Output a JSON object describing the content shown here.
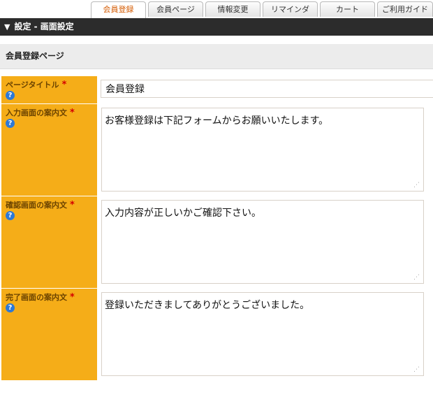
{
  "tabs": [
    {
      "label": "会員登録",
      "active": true
    },
    {
      "label": "会員ページ",
      "active": false
    },
    {
      "label": "情報変更",
      "active": false
    },
    {
      "label": "リマインダ",
      "active": false
    },
    {
      "label": "カート",
      "active": false
    },
    {
      "label": "ご利用ガイド",
      "active": false
    }
  ],
  "titlebar": {
    "icon": "triangle-down-icon",
    "text": "設定 - 画面設定"
  },
  "section": {
    "title": "会員登録ページ"
  },
  "fields": [
    {
      "label": "ページタイトル",
      "required": "*",
      "help": "?",
      "value": "会員登録"
    },
    {
      "label": "入力画面の案内文",
      "required": "*",
      "help": "?",
      "value": "お客様登録は下記フォームからお願いいたします。"
    },
    {
      "label": "確認画面の案内文",
      "required": "*",
      "help": "?",
      "value": "入力内容が正しいかご確認下さい。"
    },
    {
      "label": "完了画面の案内文",
      "required": "*",
      "help": "?",
      "value": "登録いただきましてありがとうございました。"
    }
  ],
  "colors": {
    "label_bg": "#f5ad18",
    "titlebar_bg": "#2c2c2c",
    "active_tab_text": "#d45a00",
    "help_icon": "#2d79d6",
    "required": "#d40000"
  }
}
